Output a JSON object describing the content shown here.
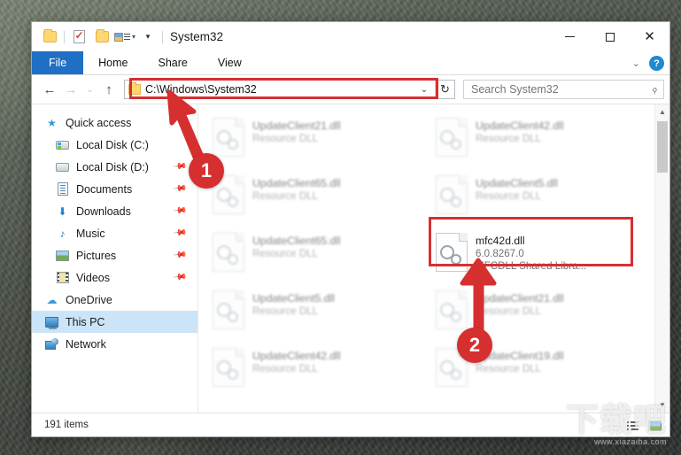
{
  "window": {
    "title": "System32",
    "quick_access_toolbar": [
      {
        "name": "folder-properties",
        "icon": "folder-icon"
      },
      {
        "name": "properties-checkmark",
        "icon": "properties-icon"
      },
      {
        "name": "new-folder",
        "icon": "folder-icon"
      },
      {
        "name": "customize-list",
        "icon": "list-view-icon"
      },
      {
        "name": "customize-dropdown",
        "icon": "chevron-down-icon"
      }
    ],
    "controls": {
      "minimize": "minimize-icon",
      "maximize": "maximize-icon",
      "close": "close-icon"
    }
  },
  "ribbon": {
    "tabs": [
      {
        "label": "File",
        "active": true
      },
      {
        "label": "Home",
        "active": false
      },
      {
        "label": "Share",
        "active": false
      },
      {
        "label": "View",
        "active": false
      }
    ],
    "collapse_icon": "chevron-down-icon",
    "help_label": "?"
  },
  "navbar": {
    "back_icon": "←",
    "forward_icon": "→",
    "recent_icon": "⌄",
    "up_icon": "↑",
    "address_value": "C:\\Windows\\System32",
    "address_dropdown_icon": "⌄",
    "refresh_icon": "↻",
    "search_placeholder": "Search System32",
    "search_value": "",
    "search_icon": "search-icon"
  },
  "sidebar": {
    "items": [
      {
        "label": "Quick access",
        "icon": "star-icon",
        "indent": false,
        "pinned": false,
        "selected": false
      },
      {
        "label": "Local Disk (C:)",
        "icon": "drive-icon",
        "indent": true,
        "pinned": false,
        "selected": false
      },
      {
        "label": "Local Disk (D:)",
        "icon": "drive-icon",
        "indent": true,
        "pinned": true,
        "selected": false
      },
      {
        "label": "Documents",
        "icon": "documents-icon",
        "indent": true,
        "pinned": true,
        "selected": false
      },
      {
        "label": "Downloads",
        "icon": "downloads-icon",
        "indent": true,
        "pinned": true,
        "selected": false
      },
      {
        "label": "Music",
        "icon": "music-icon",
        "indent": true,
        "pinned": true,
        "selected": false
      },
      {
        "label": "Pictures",
        "icon": "pictures-icon",
        "indent": true,
        "pinned": true,
        "selected": false
      },
      {
        "label": "Videos",
        "icon": "videos-icon",
        "indent": true,
        "pinned": true,
        "selected": false
      },
      {
        "label": "OneDrive",
        "icon": "cloud-icon",
        "indent": false,
        "pinned": false,
        "selected": false
      },
      {
        "label": "This PC",
        "icon": "computer-icon",
        "indent": false,
        "pinned": false,
        "selected": true
      },
      {
        "label": "Network",
        "icon": "network-icon",
        "indent": false,
        "pinned": false,
        "selected": false
      }
    ]
  },
  "files": [
    {
      "name": "UpdateClient21.dll",
      "line2": "Resource DLL",
      "line3": "",
      "highlighted": false
    },
    {
      "name": "UpdateClient42.dll",
      "line2": "Resource DLL",
      "line3": "",
      "highlighted": false
    },
    {
      "name": "UpdateClient65.dll",
      "line2": "Resource DLL",
      "line3": "",
      "highlighted": false
    },
    {
      "name": "UpdateClient5.dll",
      "line2": "Resource DLL",
      "line3": "",
      "highlighted": false
    },
    {
      "name": "UpdateClient65.dll",
      "line2": "Resource DLL",
      "line3": "",
      "highlighted": false
    },
    {
      "name": "mfc42d.dll",
      "line2": "6.0.8267.0",
      "line3": "MFCDLL Shared Libra...",
      "highlighted": true
    },
    {
      "name": "UpdateClient5.dll",
      "line2": "Resource DLL",
      "line3": "",
      "highlighted": false
    },
    {
      "name": "UpdateClient21.dll",
      "line2": "Resource DLL",
      "line3": "",
      "highlighted": false
    },
    {
      "name": "UpdateClient42.dll",
      "line2": "Resource DLL",
      "line3": "",
      "highlighted": false
    },
    {
      "name": "UpdateClient19.dll",
      "line2": "Resource DLL",
      "line3": "",
      "highlighted": false
    }
  ],
  "statusbar": {
    "items_count": "191 items",
    "view_details_icon": "details-view-icon",
    "view_tiles_icon": "tiles-view-icon"
  },
  "annotations": {
    "accent_color": "#d62f2f",
    "markers": [
      {
        "label": "1",
        "target": "address-bar"
      },
      {
        "label": "2",
        "target": "mfc42d-dll-file"
      }
    ]
  },
  "watermark": {
    "text": "下载吧",
    "subtext": "www.xiazaiba.com"
  }
}
